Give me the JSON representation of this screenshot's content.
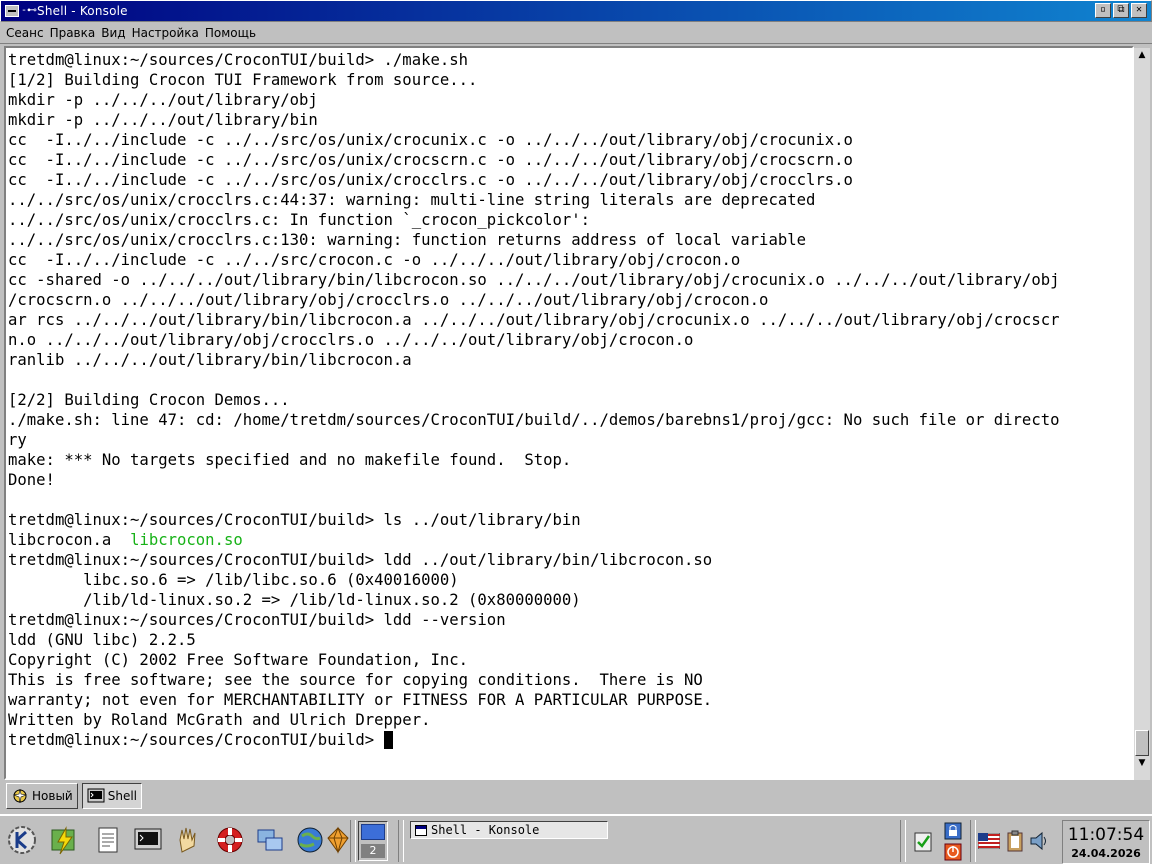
{
  "window": {
    "title": "Shell - Konsole",
    "pin_glyph": "-⊷",
    "minimize_glyph": "▫",
    "maximize_glyph": "⧉",
    "close_glyph": "✕"
  },
  "menu": {
    "items": [
      "Сеанс",
      "Правка",
      "Вид",
      "Настройка",
      "Помощь"
    ]
  },
  "terminal": {
    "lines": [
      "tretdm@linux:~/sources/CroconTUI/build> ./make.sh",
      "[1/2] Building Crocon TUI Framework from source...",
      "mkdir -p ../../../out/library/obj",
      "mkdir -p ../../../out/library/bin",
      "cc  -I../../include -c ../../src/os/unix/crocunix.c -o ../../../out/library/obj/crocunix.o",
      "cc  -I../../include -c ../../src/os/unix/crocscrn.c -o ../../../out/library/obj/crocscrn.o",
      "cc  -I../../include -c ../../src/os/unix/crocclrs.c -o ../../../out/library/obj/crocclrs.o",
      "../../src/os/unix/crocclrs.c:44:37: warning: multi-line string literals are deprecated",
      "../../src/os/unix/crocclrs.c: In function `_crocon_pickcolor':",
      "../../src/os/unix/crocclrs.c:130: warning: function returns address of local variable",
      "cc  -I../../include -c ../../src/crocon.c -o ../../../out/library/obj/crocon.o",
      "cc -shared -o ../../../out/library/bin/libcrocon.so ../../../out/library/obj/crocunix.o ../../../out/library/obj",
      "/crocscrn.o ../../../out/library/obj/crocclrs.o ../../../out/library/obj/crocon.o",
      "ar rcs ../../../out/library/bin/libcrocon.a ../../../out/library/obj/crocunix.o ../../../out/library/obj/crocscr",
      "n.o ../../../out/library/obj/crocclrs.o ../../../out/library/obj/crocon.o",
      "ranlib ../../../out/library/bin/libcrocon.a",
      "",
      "[2/2] Building Crocon Demos...",
      "./make.sh: line 47: cd: /home/tretdm/sources/CroconTUI/build/../demos/barebns1/proj/gcc: No such file or directo",
      "ry",
      "make: *** No targets specified and no makefile found.  Stop.",
      "Done!",
      "",
      "tretdm@linux:~/sources/CroconTUI/build> ls ../out/library/bin"
    ],
    "ls_output": {
      "file_a": "libcrocon.a",
      "separator": "  ",
      "file_so": "libcrocon.so",
      "so_color": "#18b218"
    },
    "lines_after": [
      "tretdm@linux:~/sources/CroconTUI/build> ldd ../out/library/bin/libcrocon.so",
      "        libc.so.6 => /lib/libc.so.6 (0x40016000)",
      "        /lib/ld-linux.so.2 => /lib/ld-linux.so.2 (0x80000000)",
      "tretdm@linux:~/sources/CroconTUI/build> ldd --version",
      "ldd (GNU libc) 2.2.5",
      "Copyright (C) 2002 Free Software Foundation, Inc.",
      "This is free software; see the source for copying conditions.  There is NO",
      "warranty; not even for MERCHANTABILITY or FITNESS FOR A PARTICULAR PURPOSE.",
      "Written by Roland McGrath and Ulrich Drepper."
    ],
    "prompt": "tretdm@linux:~/sources/CroconTUI/build> "
  },
  "scrollbar": {
    "up_glyph": "▲",
    "down_glyph": "▼",
    "position": 1.0
  },
  "sessions": {
    "new_label": "Новый",
    "shell_label": "Shell"
  },
  "taskbar": {
    "pager_number": "2",
    "task_title": "Shell - Konsole",
    "clock_time": "11:07:54",
    "clock_date": "24.04.2026",
    "launchers": [
      "kde-menu-icon",
      "lightning-icon",
      "document-icon",
      "terminal-icon",
      "hand-icon",
      "lifebuoy-icon",
      "network-icon",
      "globe-icon",
      "diamond-icon"
    ],
    "tray": [
      "clipboard-icon",
      "lock-icon",
      "power-icon",
      "flag-icon",
      "klipper-icon",
      "speaker-icon"
    ],
    "colors": {
      "titlebar_start": "#000080",
      "titlebar_end": "#1084d0",
      "desktop_pager": "#3c6ed8"
    }
  }
}
